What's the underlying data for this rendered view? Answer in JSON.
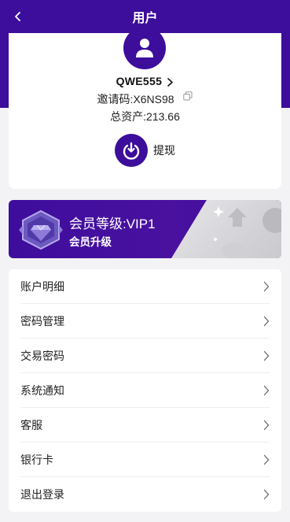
{
  "header": {
    "title": "用户"
  },
  "profile": {
    "username": "QWE555",
    "invite_label": "邀请码:",
    "invite_code": "X6NS98",
    "assets_label": "总资产:",
    "assets_value": "213.66",
    "withdraw_label": "提现"
  },
  "vip": {
    "level_text": "会员等级:VIP1",
    "upgrade_text": "会员升级"
  },
  "menu": {
    "items": [
      {
        "label": "账户明细"
      },
      {
        "label": "密码管理"
      },
      {
        "label": "交易密码"
      },
      {
        "label": "系统通知"
      },
      {
        "label": "客服"
      },
      {
        "label": "银行卡"
      },
      {
        "label": "退出登录"
      }
    ]
  },
  "colors": {
    "primary": "#3d0d9c",
    "background": "#f3f3f5",
    "card": "#ffffff"
  },
  "icons": {
    "back": "chevron-left-icon",
    "avatar": "user-icon",
    "copy": "copy-icon",
    "withdraw": "withdraw-icon",
    "vip_badge": "diamond-badge-icon",
    "menu_arrow": "chevron-right-icon"
  }
}
